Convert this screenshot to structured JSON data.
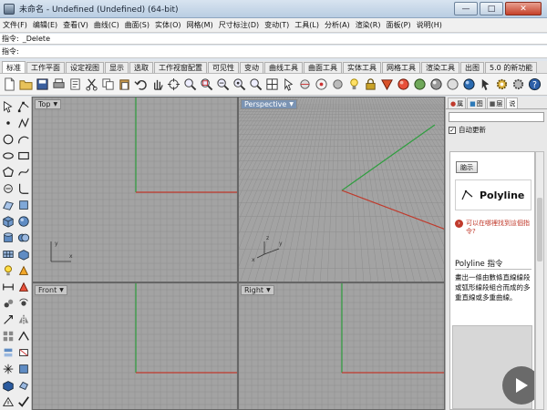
{
  "window": {
    "title": "未命名 - Undefined (Undefined) (64-bit)",
    "minimize": "—",
    "maximize": "□",
    "close": "✕"
  },
  "menu": [
    "文件(F)",
    "编辑(E)",
    "查看(V)",
    "曲线(C)",
    "曲面(S)",
    "实体(O)",
    "网格(M)",
    "尺寸标注(D)",
    "变动(T)",
    "工具(L)",
    "分析(A)",
    "渲染(R)",
    "面板(P)",
    "说明(H)"
  ],
  "command_history": {
    "label": "指令:",
    "value": "_Delete"
  },
  "command_prompt": {
    "label": "指令:",
    "value": ""
  },
  "toolbar_tabs": [
    "标准",
    "工作平面",
    "设定视图",
    "显示",
    "选取",
    "工作视窗配置",
    "可见性",
    "变动",
    "曲线工具",
    "曲面工具",
    "实体工具",
    "网格工具",
    "渲染工具",
    "出图",
    "5.0 的新功能"
  ],
  "active_tab_index": 0,
  "viewports": {
    "top": "Top",
    "perspective": "Perspective",
    "front": "Front",
    "right": "Right"
  },
  "help_panel": {
    "tabs": [
      "属",
      "图",
      "层",
      "说"
    ],
    "auto_update_label": "自动更新",
    "auto_update_checked": true,
    "checkmark": "✓",
    "toggle_button": "脑示",
    "command_name": "Polyline",
    "tip": "可以在哪裡找到這個指令?",
    "heading": "Polyline 指令",
    "description": "畫出一條由數條直線線段或弧形線段組合而成的多重直線或多重曲線。"
  },
  "colors": {
    "viewport_bg": "#a3a3a3",
    "grid": "#8e8e8e",
    "x_axis": "#c0392b",
    "y_axis": "#2e9e3e",
    "active_label": "#7a93b3"
  }
}
